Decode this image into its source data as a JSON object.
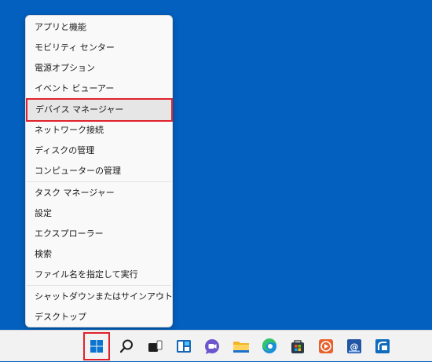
{
  "context_menu": {
    "items": [
      {
        "label": "アプリと機能"
      },
      {
        "label": "モビリティ センター"
      },
      {
        "label": "電源オプション"
      },
      {
        "label": "イベント ビューアー"
      },
      {
        "label": "デバイス マネージャー",
        "highlighted": true
      },
      {
        "label": "ネットワーク接続"
      },
      {
        "label": "ディスクの管理"
      },
      {
        "label": "コンピューターの管理"
      },
      {
        "label": "タスク マネージャー"
      },
      {
        "label": "設定"
      },
      {
        "label": "エクスプローラー"
      },
      {
        "label": "検索"
      },
      {
        "label": "ファイル名を指定して実行"
      },
      {
        "label": "シャットダウンまたはサインアウト",
        "submenu": true
      },
      {
        "label": "デスクトップ"
      }
    ],
    "submenu_arrow": "›"
  },
  "taskbar": {
    "icons": [
      "start-icon",
      "search-icon",
      "task-view-icon",
      "widgets-icon",
      "chat-icon",
      "file-explorer-icon",
      "edge-icon",
      "store-icon",
      "media-player-icon",
      "mail-icon",
      "remote-app-icon"
    ]
  },
  "colors": {
    "desktop": "#0360be",
    "highlight_border": "#e0222c",
    "accent": "#0078d4"
  }
}
